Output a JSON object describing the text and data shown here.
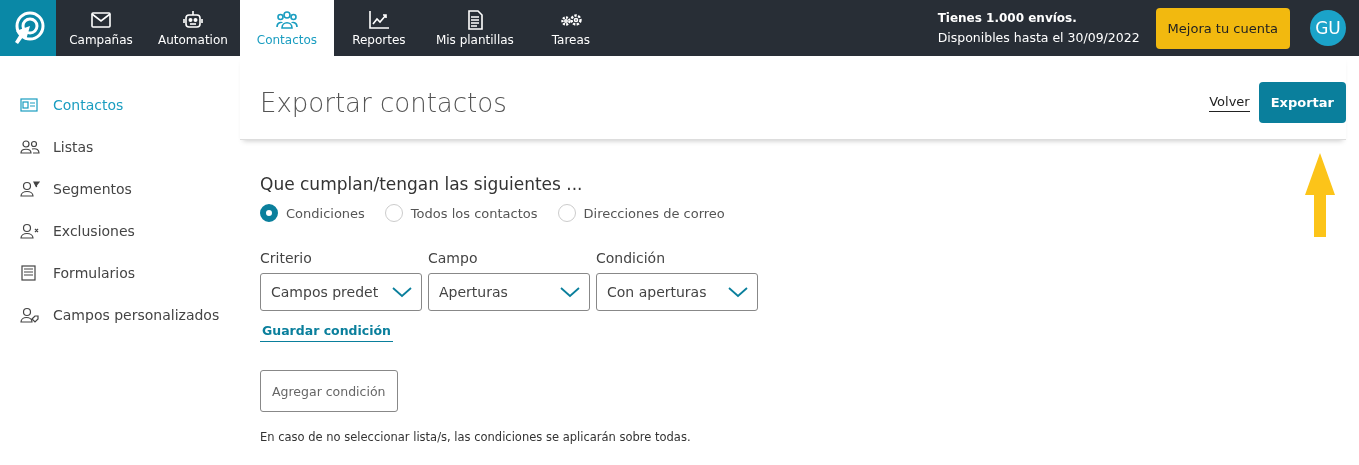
{
  "nav": [
    {
      "label": "Campañas",
      "selected": false
    },
    {
      "label": "Automation",
      "selected": false
    },
    {
      "label": "Contactos",
      "selected": true
    },
    {
      "label": "Reportes",
      "selected": false
    },
    {
      "label": "Mis plantillas",
      "selected": false
    },
    {
      "label": "Tareas",
      "selected": false
    }
  ],
  "account": {
    "sends": "Tienes 1.000 envíos.",
    "available": "Disponibles hasta el 30/09/2022",
    "upgrade": "Mejora tu cuenta",
    "avatar": "GU"
  },
  "sidebar": {
    "items": [
      {
        "label": "Contactos",
        "selected": true
      },
      {
        "label": "Listas",
        "selected": false
      },
      {
        "label": "Segmentos",
        "selected": false
      },
      {
        "label": "Exclusiones",
        "selected": false
      },
      {
        "label": "Formularios",
        "selected": false
      },
      {
        "label": "Campos personalizados",
        "selected": false
      }
    ]
  },
  "page": {
    "title": "Exportar contactos",
    "back": "Volver",
    "export": "Exportar"
  },
  "filter": {
    "heading": "Que cumplan/tengan las siguientes ...",
    "options": [
      {
        "label": "Condiciones",
        "selected": true
      },
      {
        "label": "Todos los contactos",
        "selected": false
      },
      {
        "label": "Direcciones de correo",
        "selected": false
      }
    ],
    "fields": [
      {
        "label": "Criterio",
        "value": "Campos predet"
      },
      {
        "label": "Campo",
        "value": "Aperturas"
      },
      {
        "label": "Condición",
        "value": "Con aperturas"
      }
    ],
    "save": "Guardar condición",
    "add": "Agregar condición",
    "note": "En caso de no seleccionar lista/s, las condiciones se aplicarán sobre todas."
  }
}
